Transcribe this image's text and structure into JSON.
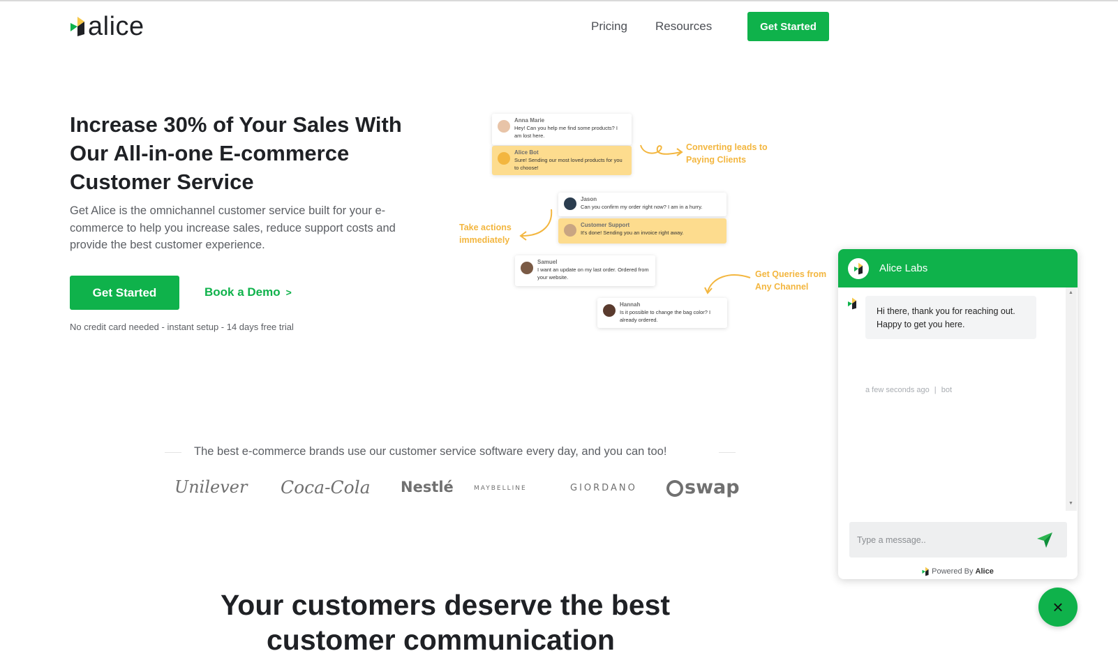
{
  "header": {
    "logo_text": "alice",
    "nav": [
      "Pricing",
      "Resources"
    ],
    "cta": "Get Started"
  },
  "hero": {
    "title": "Increase 30% of Your Sales With Our All-in-one E-commerce Customer Service",
    "description": "Get Alice is the omnichannel customer service built for your e-commerce to help you increase sales, reduce support costs and provide the best customer experience.",
    "cta": "Get Started",
    "demo_link": "Book a Demo",
    "demo_chevron": ">",
    "note": "No credit card needed - instant setup - 14 days free trial"
  },
  "illustration": {
    "cards": [
      {
        "name": "Anna Marie",
        "message": "Hey! Can you help me find some products? I am lost here."
      },
      {
        "name": "Alice Bot",
        "message": "Sure! Sending our most loved products for you to choose!"
      },
      {
        "name": "Jason",
        "message": "Can you confirm my order right now? I am in a hurry."
      },
      {
        "name": "Customer Support",
        "message": "It's done! Sending you an invoice right away."
      },
      {
        "name": "Samuel",
        "message": "I want an update on my last order. Ordered from your website."
      },
      {
        "name": "Hannah",
        "message": "Is it possible to change the bag color? I already ordered."
      }
    ],
    "annotations": [
      "Converting leads to Paying Clients",
      "Take actions immediately",
      "Get Queries from Any Channel"
    ]
  },
  "brands": {
    "caption": "The best e-commerce brands use our customer service software every day, and you can too!",
    "logos": [
      "Unilever",
      "Coca-Cola",
      "Nestlé",
      "MAYBELLINE",
      "GIORDANO",
      "swap"
    ]
  },
  "section": {
    "title_line1": "Your customers deserve the best",
    "title_line2": "customer communication"
  },
  "chat": {
    "title": "Alice Labs",
    "message": "Hi there, thank you for reaching out. Happy to get you here.",
    "timestamp": "a few seconds ago",
    "separator": "|",
    "sender": "bot",
    "input_placeholder": "Type a message..",
    "powered_prefix": "Powered By",
    "powered_brand": "Alice",
    "close_icon": "×"
  },
  "colors": {
    "brand_green": "#0fb24b",
    "accent_yellow": "#f3b63f",
    "card_yellow": "#fddc8e"
  }
}
